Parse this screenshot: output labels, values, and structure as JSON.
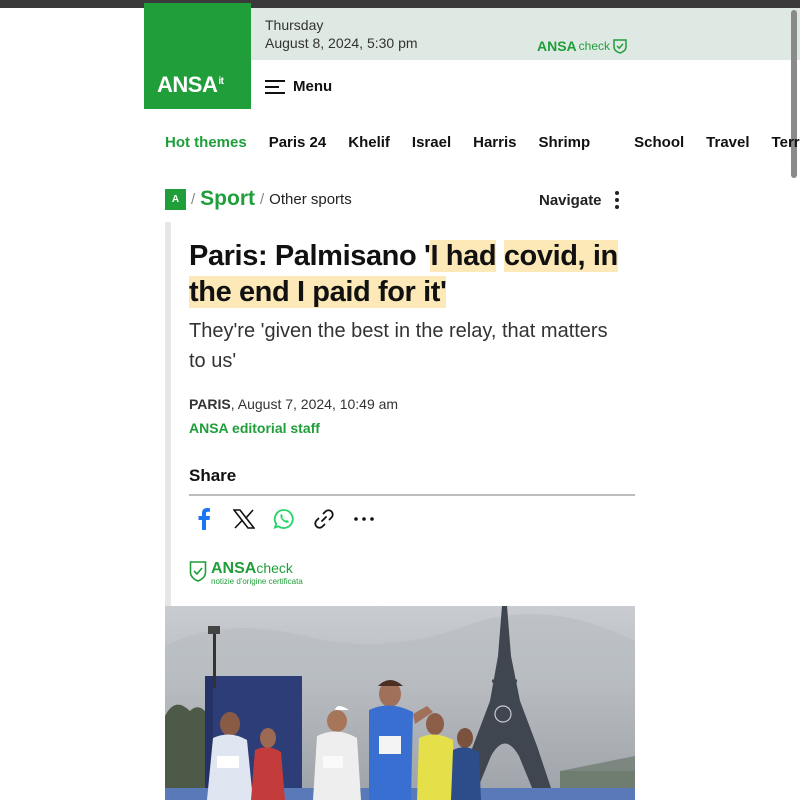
{
  "header": {
    "day": "Thursday",
    "date": "August 8, 2024, 5:30 pm",
    "logo": "ANSA",
    "logo_suffix": "it",
    "check_brand": "ANSA",
    "check_word": "check",
    "menu_label": "Menu"
  },
  "themes": [
    "Hot themes",
    "Paris 24",
    "Khelif",
    "Israel",
    "Harris",
    "Shrimp",
    "School",
    "Travel",
    "Terra"
  ],
  "breadcrumb": {
    "home_icon_text": "A",
    "section": "Sport",
    "subsection": "Other sports",
    "navigate": "Navigate"
  },
  "article": {
    "headline_plain": "Paris: Palmisano '",
    "headline_hl1": "I had",
    "headline_hl2": "covid, in the end I paid for it'",
    "subtitle": "They're 'given the best in the relay, that matters to us'",
    "place": "PARIS",
    "date": ", August 7, 2024, 10:49 am",
    "author": "ANSA editorial staff",
    "share_title": "Share",
    "check_brand": "ANSA",
    "check_word": "check",
    "check_tagline": "notizie d'origine certificata"
  },
  "icons": {
    "facebook": "facebook-icon",
    "x": "x-icon",
    "whatsapp": "whatsapp-icon",
    "link": "link-icon",
    "more": "more-icon",
    "menu": "hamburger-icon",
    "navigate": "kebab-icon"
  },
  "colors": {
    "brand_green": "#1f9e3a",
    "highlight": "#fde9b8",
    "topbar": "#dfe9e3",
    "facebook": "#1877f2",
    "whatsapp": "#25d366"
  }
}
